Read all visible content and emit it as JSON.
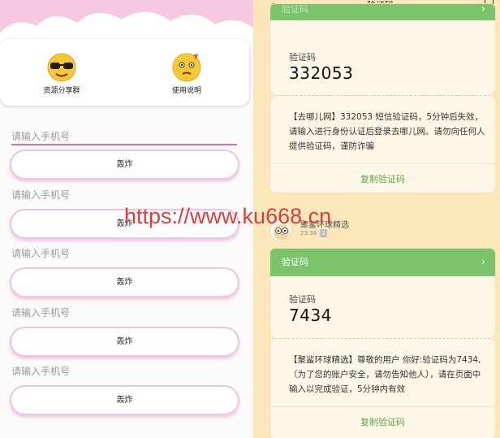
{
  "left": {
    "shortcuts": [
      {
        "label": "资源分享群",
        "icon": "sunglasses-emoji-icon"
      },
      {
        "label": "使用说明",
        "icon": "confused-emoji-icon"
      }
    ],
    "rows": [
      {
        "placeholder": "请输入手机号",
        "button": "轰炸"
      },
      {
        "placeholder": "请输入手机号",
        "button": "轰炸"
      },
      {
        "placeholder": "请输入手机号",
        "button": "轰炸"
      },
      {
        "placeholder": "请输入手机号",
        "button": "轰炸"
      },
      {
        "placeholder": "请输入手机号",
        "button": "轰炸"
      }
    ],
    "colors": {
      "accent": "#e1709a",
      "header": "#f6c9e1",
      "button_border": "#efc4e0"
    }
  },
  "right": {
    "header": {
      "title": "验证码",
      "back_icon": "‹",
      "menu_icon": "square-outline-icon"
    },
    "card1": {
      "head": "验证码",
      "code_label": "验证码",
      "code": "332053",
      "message": "【去哪儿网】332053 短信验证码，5分钟后失效，请输入进行身份认证后登录去哪儿网。请勿向任何人提供验证码，谨防诈骗",
      "copy": "复制验证码"
    },
    "sender": {
      "name": "聚鲨环球精选",
      "time": "23:38",
      "sim": "2"
    },
    "card2": {
      "head": "验证码",
      "code_label": "验证码",
      "code": "7434",
      "message": "【聚鲨环球精选】尊敬的用户 你好:验证码为7434,（为了您的账户安全，请勿告知他人），请在页面中输入以完成验证，5分钟内有效",
      "copy": "复制验证码"
    },
    "colors": {
      "background": "#fde8bc",
      "card_head": "#7cc46b",
      "copy": "#5aa94c"
    }
  },
  "watermark": "https://www.ku668.cn"
}
